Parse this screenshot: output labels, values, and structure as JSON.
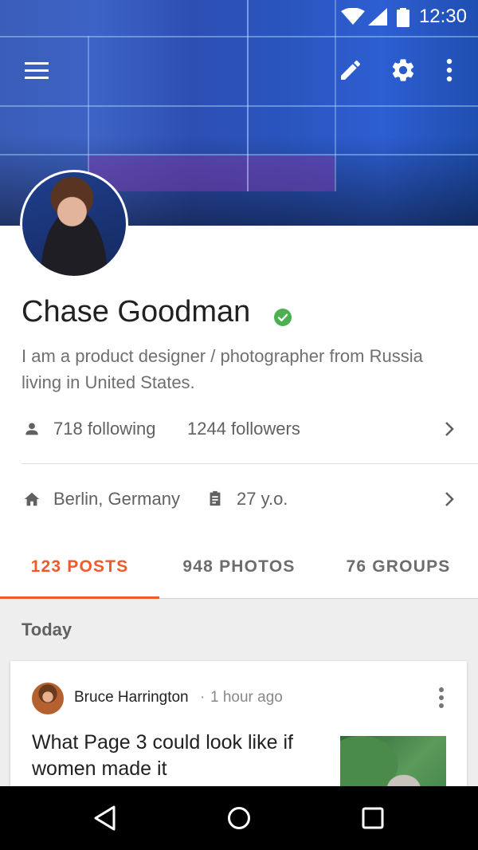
{
  "status_bar": {
    "time": "12:30"
  },
  "toolbar": {
    "menu_icon": "menu-icon",
    "edit_icon": "edit-icon",
    "settings_icon": "gear-icon",
    "more_icon": "more-vert-icon"
  },
  "profile": {
    "name": "Chase Goodman",
    "bio": "I am a product designer / photographer from Russia living in United States.",
    "following": "718 following",
    "followers": "1244 followers",
    "location": "Berlin, Germany",
    "age": "27 y.o."
  },
  "tabs": [
    {
      "label": "123 POSTS",
      "active": true
    },
    {
      "label": "948 PHOTOS",
      "active": false
    },
    {
      "label": "76 GROUPS",
      "active": false
    }
  ],
  "feed": {
    "section_title": "Today",
    "post": {
      "author": "Bruce Harrington",
      "separator": "·",
      "time": "1 hour ago",
      "title": "What Page 3 could look like if women made it"
    }
  },
  "colors": {
    "accent": "#f05a28",
    "verified": "#4caf50",
    "cover": "#2d55be"
  }
}
